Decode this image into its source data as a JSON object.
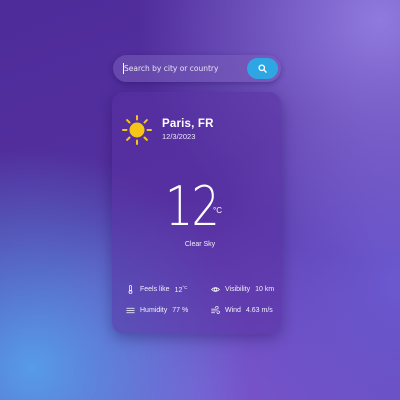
{
  "search": {
    "placeholder": "Search by city or country"
  },
  "location": {
    "name": "Paris, FR",
    "date": "12/3/2023"
  },
  "current": {
    "temperature": "12",
    "unit": "°C",
    "condition": "Clear Sky",
    "icon": "sun-icon"
  },
  "details": {
    "feels_like": {
      "label": "Feels like",
      "value": "12",
      "unit": "°C",
      "icon": "thermometer-icon"
    },
    "visibility": {
      "label": "Visibility",
      "value": "10 km",
      "icon": "eye-icon"
    },
    "humidity": {
      "label": "Humidity",
      "value": "77 %",
      "icon": "humidity-icon"
    },
    "wind": {
      "label": "Wind",
      "value": "4.63 m/s",
      "icon": "wind-icon"
    }
  },
  "colors": {
    "accent": "#2fa6e4",
    "sun": "#f5c518",
    "card": "#5830a0"
  }
}
